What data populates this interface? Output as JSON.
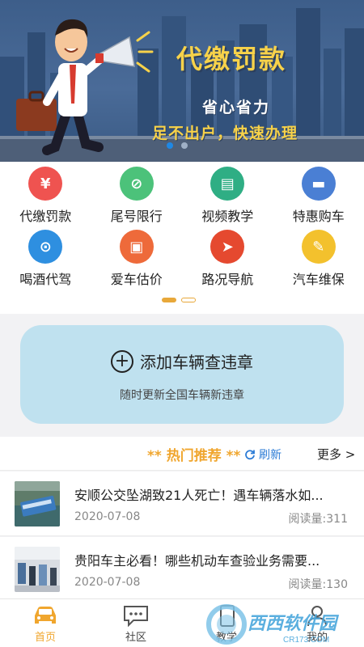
{
  "banner": {
    "title": "代缴罚款",
    "subtitle1": "省心省力",
    "subtitle2": "足不出户，快速办理",
    "dots": 2,
    "active_dot": 0
  },
  "grid": {
    "items": [
      {
        "label": "代缴罚款",
        "icon": "yen-icon",
        "glyph": "¥",
        "color": "#ef5350"
      },
      {
        "label": "尾号限行",
        "icon": "no-entry-icon",
        "glyph": "⊘",
        "color": "#4cc27a"
      },
      {
        "label": "视频教学",
        "icon": "book-icon",
        "glyph": "▤",
        "color": "#2fae84"
      },
      {
        "label": "特惠购车",
        "icon": "car-icon",
        "glyph": "▬",
        "color": "#4a7fd4"
      },
      {
        "label": "喝酒代驾",
        "icon": "steering-wheel-icon",
        "glyph": "⊙",
        "color": "#2e8fe0"
      },
      {
        "label": "爱车估价",
        "icon": "car-value-icon",
        "glyph": "▣",
        "color": "#ee6a3a"
      },
      {
        "label": "路况导航",
        "icon": "navigation-icon",
        "glyph": "➤",
        "color": "#e5492f"
      },
      {
        "label": "汽车维保",
        "icon": "wrench-icon",
        "glyph": "✎",
        "color": "#f3c12d"
      }
    ],
    "pages": 2,
    "active_page": 0
  },
  "add_vehicle": {
    "title": "添加车辆查违章",
    "subtitle": "随时更新全国车辆新违章"
  },
  "hot": {
    "title": "** 热门推荐 **",
    "refresh": "刷新",
    "more": "更多 >"
  },
  "news": [
    {
      "title": "安顺公交坠湖致21人死亡！遇车辆落水如...",
      "date": "2020-07-08",
      "reads": "阅读量:311"
    },
    {
      "title": "贵阳车主必看！哪些机动车查验业务需要...",
      "date": "2020-07-08",
      "reads": "阅读量:130"
    }
  ],
  "tabs": [
    {
      "label": "首页",
      "icon": "car-home-icon",
      "active": true
    },
    {
      "label": "社区",
      "icon": "chat-icon",
      "active": false
    },
    {
      "label": "教学",
      "icon": "phone-icon",
      "active": false
    },
    {
      "label": "我的",
      "icon": "profile-icon",
      "active": false
    }
  ],
  "watermark": {
    "brand": "西西软件园",
    "site": "CR173.COM"
  },
  "colors": {
    "accent": "#f0a62e",
    "link": "#2b7bd6",
    "card": "#bfe1ef"
  }
}
